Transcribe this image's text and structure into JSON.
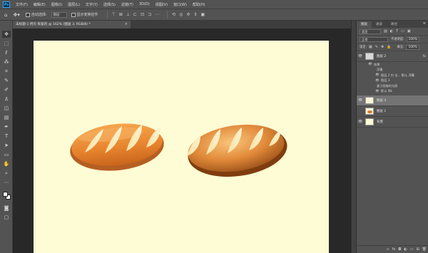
{
  "app": {
    "logo": "Ps"
  },
  "menu": [
    "文件(F)",
    "编辑(E)",
    "图像(I)",
    "图层(L)",
    "文字(Y)",
    "选择(S)",
    "滤镜(T)",
    "3D(D)",
    "视图(V)",
    "窗口(W)",
    "帮助(H)"
  ],
  "options": {
    "auto_select_label": "自动选择:",
    "auto_select_value": "图层",
    "transform_label": "显示变换控件"
  },
  "document": {
    "tab_title": "未标题-1 拷贝-恢复的 @ 162% (图层 3, RGB/8) *",
    "close": "×"
  },
  "canvas": {
    "background": "#fefcd4"
  },
  "panel": {
    "tabs": [
      "图层",
      "通道",
      "路径"
    ],
    "filter_label": "类型",
    "blend_mode": "正常",
    "opacity_label": "不透明度:",
    "opacity_value": "100%",
    "lock_label": "锁定:",
    "fill_label": "填充:",
    "fill_value": "100%"
  },
  "layers": [
    {
      "name": "图层 2",
      "fx": "fx",
      "selected": false
    },
    {
      "name": "图层 3",
      "fx": "",
      "selected": true
    },
    {
      "name": "图层 1",
      "fx": "",
      "selected": false
    },
    {
      "name": "背景",
      "fx": "",
      "selected": false
    }
  ],
  "effects": {
    "title": "效果",
    "sub1": "浮雕",
    "sub1_a": "图层 2 内 全... 默认 浮雕",
    "sub1_b": "图层 3",
    "sub2": "基于图像的光照",
    "sub2_a": "默认 IBL"
  },
  "icons": {
    "move": "move-icon",
    "marquee": "marquee-icon",
    "lasso": "lasso-icon",
    "wand": "magic-wand-icon",
    "crop": "crop-icon",
    "eyedropper": "eyedropper-icon",
    "brush": "brush-icon",
    "stamp": "clone-stamp-icon",
    "eraser": "eraser-icon",
    "gradient": "gradient-icon",
    "pen": "pen-icon",
    "type": "type-icon",
    "path-select": "path-select-icon",
    "shape": "shape-icon",
    "hand": "hand-icon",
    "zoom": "zoom-icon"
  },
  "colors": {
    "accent": "#31a8ff",
    "ui_bg": "#535353",
    "bread_dark": "#b65f22",
    "bread_light": "#f3a24c"
  }
}
